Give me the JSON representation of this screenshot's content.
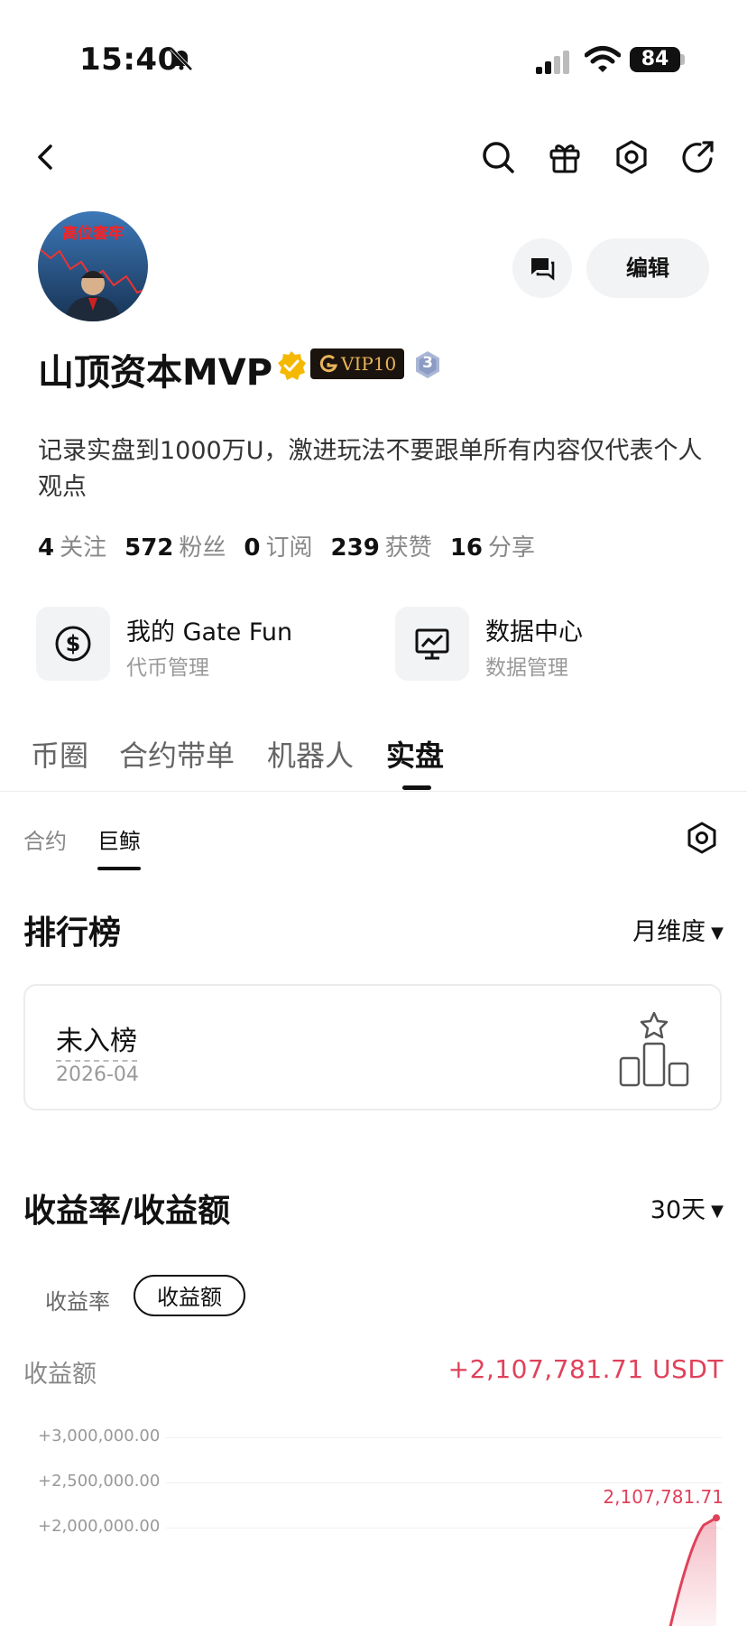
{
  "status_bar": {
    "time": "15:40",
    "battery": "84"
  },
  "header": {
    "icons": [
      "back-arrow-icon",
      "search-icon",
      "gift-icon",
      "settings-hex-icon",
      "share-icon"
    ]
  },
  "profile": {
    "avatar_text": "高位套牢",
    "name": "山顶资本MVP",
    "vip_label": "VIP10",
    "level": "3",
    "message_icon": "chat-icon",
    "edit_label": "编辑",
    "bio": "记录实盘到1000万U，激进玩法不要跟单所有内容仅代表个人观点"
  },
  "stats": [
    {
      "value": "4",
      "label": "关注"
    },
    {
      "value": "572",
      "label": "粉丝"
    },
    {
      "value": "0",
      "label": "订阅"
    },
    {
      "value": "239",
      "label": "获赞"
    },
    {
      "value": "16",
      "label": "分享"
    }
  ],
  "cards": [
    {
      "title": "我的 Gate Fun",
      "subtitle": "代币管理",
      "icon": "dollar-coin-icon"
    },
    {
      "title": "数据中心",
      "subtitle": "数据管理",
      "icon": "chart-monitor-icon"
    }
  ],
  "tabs": [
    "币圈",
    "合约带单",
    "机器人",
    "实盘"
  ],
  "active_tab": "实盘",
  "subtabs": [
    "合约",
    "巨鲸"
  ],
  "active_subtab": "巨鲸",
  "ranking": {
    "title": "排行榜",
    "period": "月维度",
    "status": "未入榜",
    "date": "2026-04"
  },
  "pnl": {
    "title": "收益率/收益额",
    "range": "30天",
    "chips": [
      "收益率",
      "收益额"
    ],
    "active_chip": "收益额",
    "metric_label": "收益额",
    "metric_value": "+2,107,781.71 USDT"
  },
  "chart_data": {
    "type": "area",
    "y_ticks": [
      "+3,000,000.00",
      "+2,500,000.00",
      "+2,000,000.00"
    ],
    "ylim": [
      2000000,
      3000000
    ],
    "last_point_label": "2,107,781.71",
    "last_value": 2107781.71,
    "accent_color": "#e0415a"
  },
  "colors": {
    "accent": "#e0415a",
    "vip_gold": "#e8b55a"
  }
}
